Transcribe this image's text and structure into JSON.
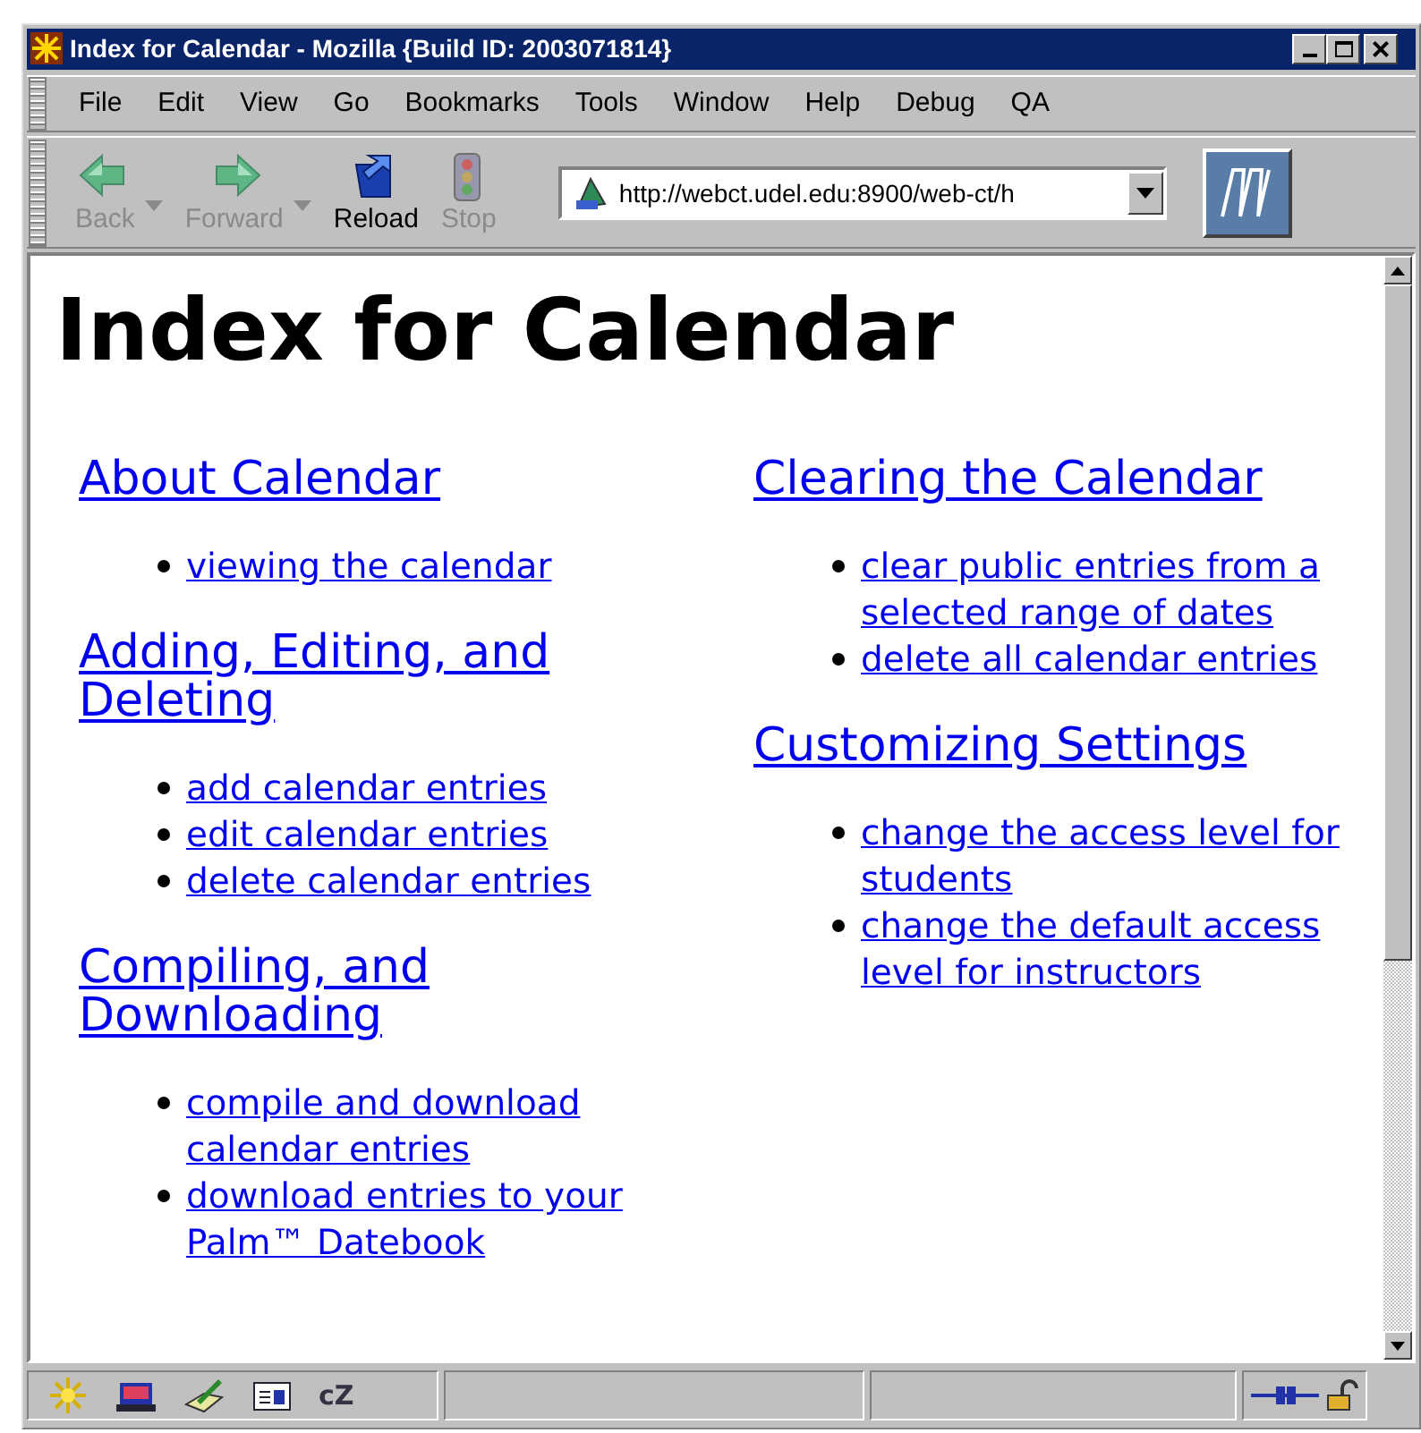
{
  "window": {
    "title": "Index for Calendar - Mozilla {Build ID: 2003071814}"
  },
  "menu": [
    "File",
    "Edit",
    "View",
    "Go",
    "Bookmarks",
    "Tools",
    "Window",
    "Help",
    "Debug",
    "QA"
  ],
  "toolbar": {
    "buttons": [
      {
        "kind": "back",
        "label": "Back",
        "disabled": true
      },
      {
        "kind": "forward",
        "label": "Forward",
        "disabled": true
      },
      {
        "kind": "reload",
        "label": "Reload",
        "disabled": false
      },
      {
        "kind": "stop",
        "label": "Stop",
        "disabled": true
      }
    ],
    "address": "http://webct.udel.edu:8900/web-ct/h"
  },
  "page": {
    "heading": "Index for Calendar",
    "columns": [
      [
        {
          "title": "About Calendar",
          "links": [
            "viewing the calendar"
          ]
        },
        {
          "title": "Adding, Editing, and Deleting",
          "links": [
            "add calendar entries",
            "edit calendar entries",
            "delete calendar entries"
          ]
        },
        {
          "title": "Compiling, and Downloading",
          "links": [
            "compile and download calendar entries",
            "download entries to your Palm™ Datebook"
          ]
        }
      ],
      [
        {
          "title": "Clearing the Calendar",
          "links": [
            "clear public entries from a selected range of dates",
            "delete all calendar entries"
          ]
        },
        {
          "title": "Customizing Settings",
          "links": [
            "change the access level for students",
            "change the default access level for instructors"
          ]
        }
      ]
    ]
  },
  "status_bar": {
    "chat_label": "cZ"
  }
}
